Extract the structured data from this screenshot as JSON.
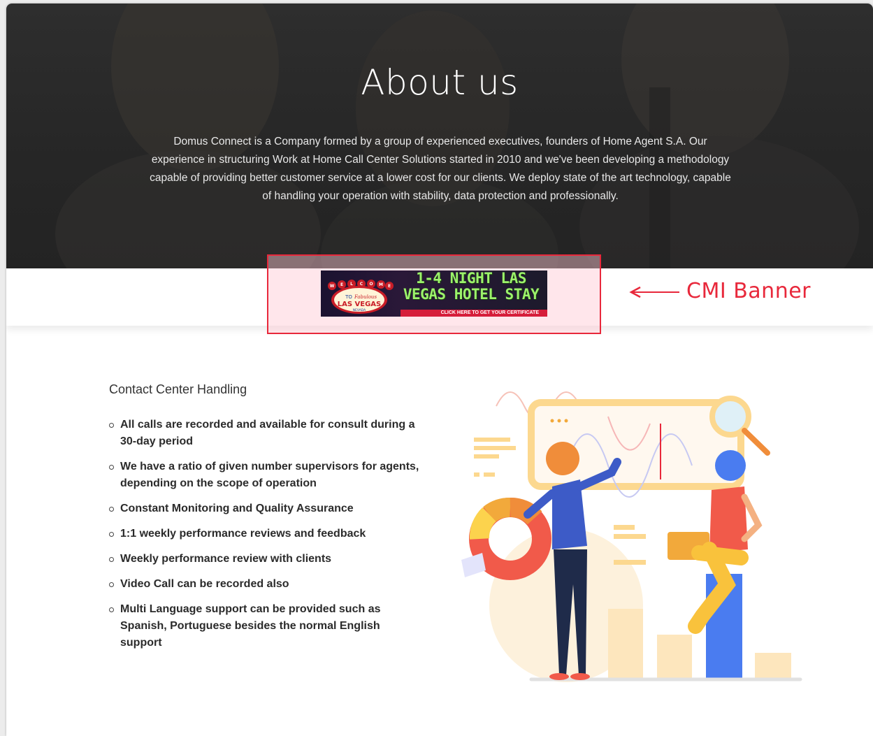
{
  "hero": {
    "title": "About us",
    "description": "Domus Connect is a Company formed by a group of experienced executives, founders of Home Agent S.A. Our experience in structuring Work at Home Call Center Solutions started in 2010 and we've been developing a methodology capable of providing better customer service at a lower cost for our clients. We deploy state of the art technology, capable of handling your operation with stability, data protection and professionally."
  },
  "ad_banner": {
    "sign_welcome": "WELCOME",
    "sign_to": "TO",
    "sign_fabulous": "Fabulous",
    "sign_city": "LAS VEGAS",
    "sign_state": "NEVADA",
    "headline_line1": "1-4 NIGHT LAS",
    "headline_line2": "VEGAS HOTEL STAY",
    "cta": "CLICK HERE TO GET YOUR CERTIFICATE"
  },
  "annotation": {
    "label": "CMI Banner",
    "color": "#e8283b"
  },
  "contact_section": {
    "title": "Contact Center Handling",
    "items": [
      "All calls are recorded and available for consult during a 30-day period",
      "We have a ratio of given number supervisors for agents, depending on the scope of operation",
      "Constant Monitoring and Quality Assurance",
      "1:1 weekly performance reviews and feedback",
      "Weekly performance review with clients",
      "Video Call can be recorded also",
      "Multi Language support can be provided such as Spanish, Portuguese besides the normal English support"
    ]
  },
  "colors": {
    "hero_bg": "#262626",
    "accent_red": "#e8283b",
    "illustration_orange": "#f2a93b",
    "illustration_blue": "#4a7cf0"
  }
}
